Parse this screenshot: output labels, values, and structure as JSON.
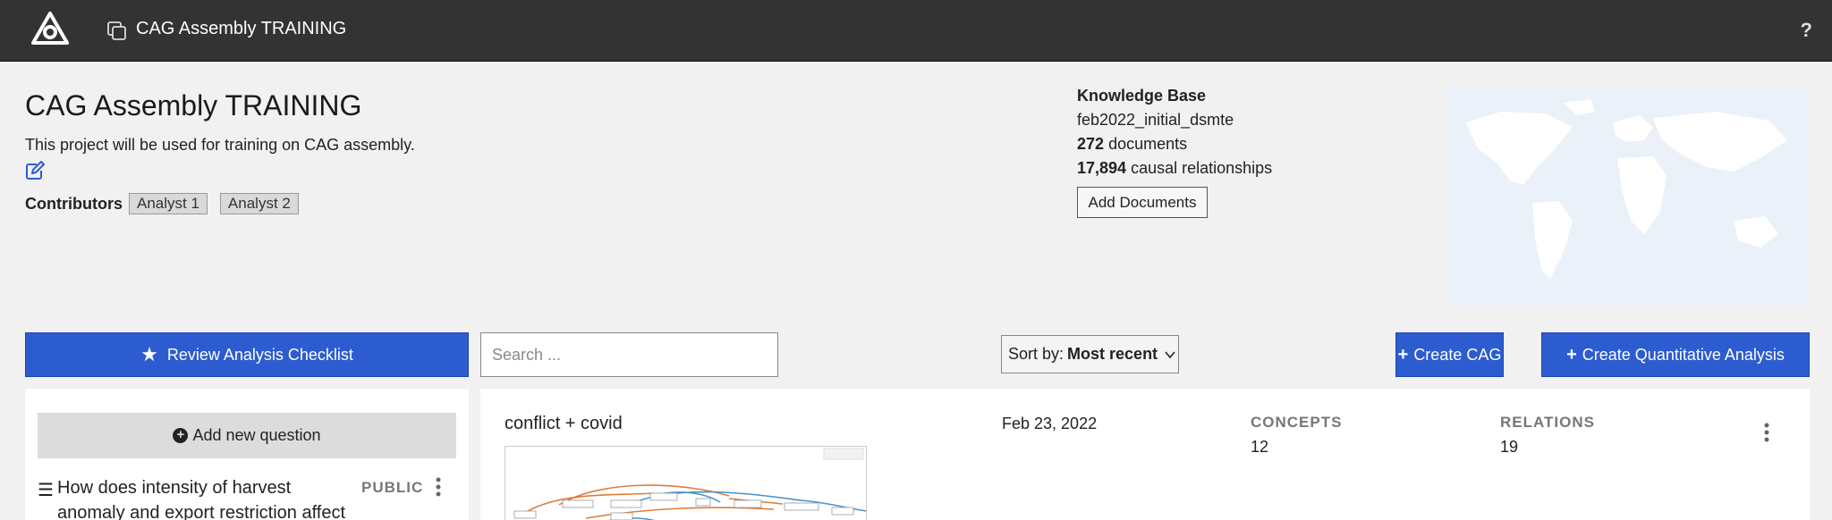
{
  "header": {
    "project_title": "CAG Assembly TRAINING",
    "help_label": "?"
  },
  "project": {
    "title": "CAG Assembly TRAINING",
    "description": "This project will be used for training on CAG assembly.",
    "contributors_label": "Contributors",
    "contributors": [
      "Analyst 1",
      "Analyst 2"
    ]
  },
  "knowledge_base": {
    "heading": "Knowledge Base",
    "name": "feb2022_initial_dsmte",
    "documents_count": "272",
    "documents_label": "documents",
    "relationships_count": "17,894",
    "relationships_label": "causal relationships",
    "add_documents_label": "Add Documents"
  },
  "toolbar": {
    "review_label": "Review Analysis Checklist",
    "search_placeholder": "Search ...",
    "sort_prefix": "Sort by:",
    "sort_value": "Most recent",
    "create_cag_label": "Create CAG",
    "create_quant_label": "Create Quantitative Analysis"
  },
  "questions": {
    "add_label": "Add new question",
    "items": [
      {
        "text": "How does intensity of harvest anomaly and export restriction affect",
        "visibility": "PUBLIC"
      }
    ]
  },
  "cags": [
    {
      "title": "conflict + covid",
      "date": "Feb 23, 2022",
      "concepts_label": "CONCEPTS",
      "concepts": "12",
      "relations_label": "RELATIONS",
      "relations": "19"
    }
  ],
  "colors": {
    "topbar": "#333333",
    "primary_button": "#2d5cd0",
    "edit_icon": "#2d5cd0"
  }
}
